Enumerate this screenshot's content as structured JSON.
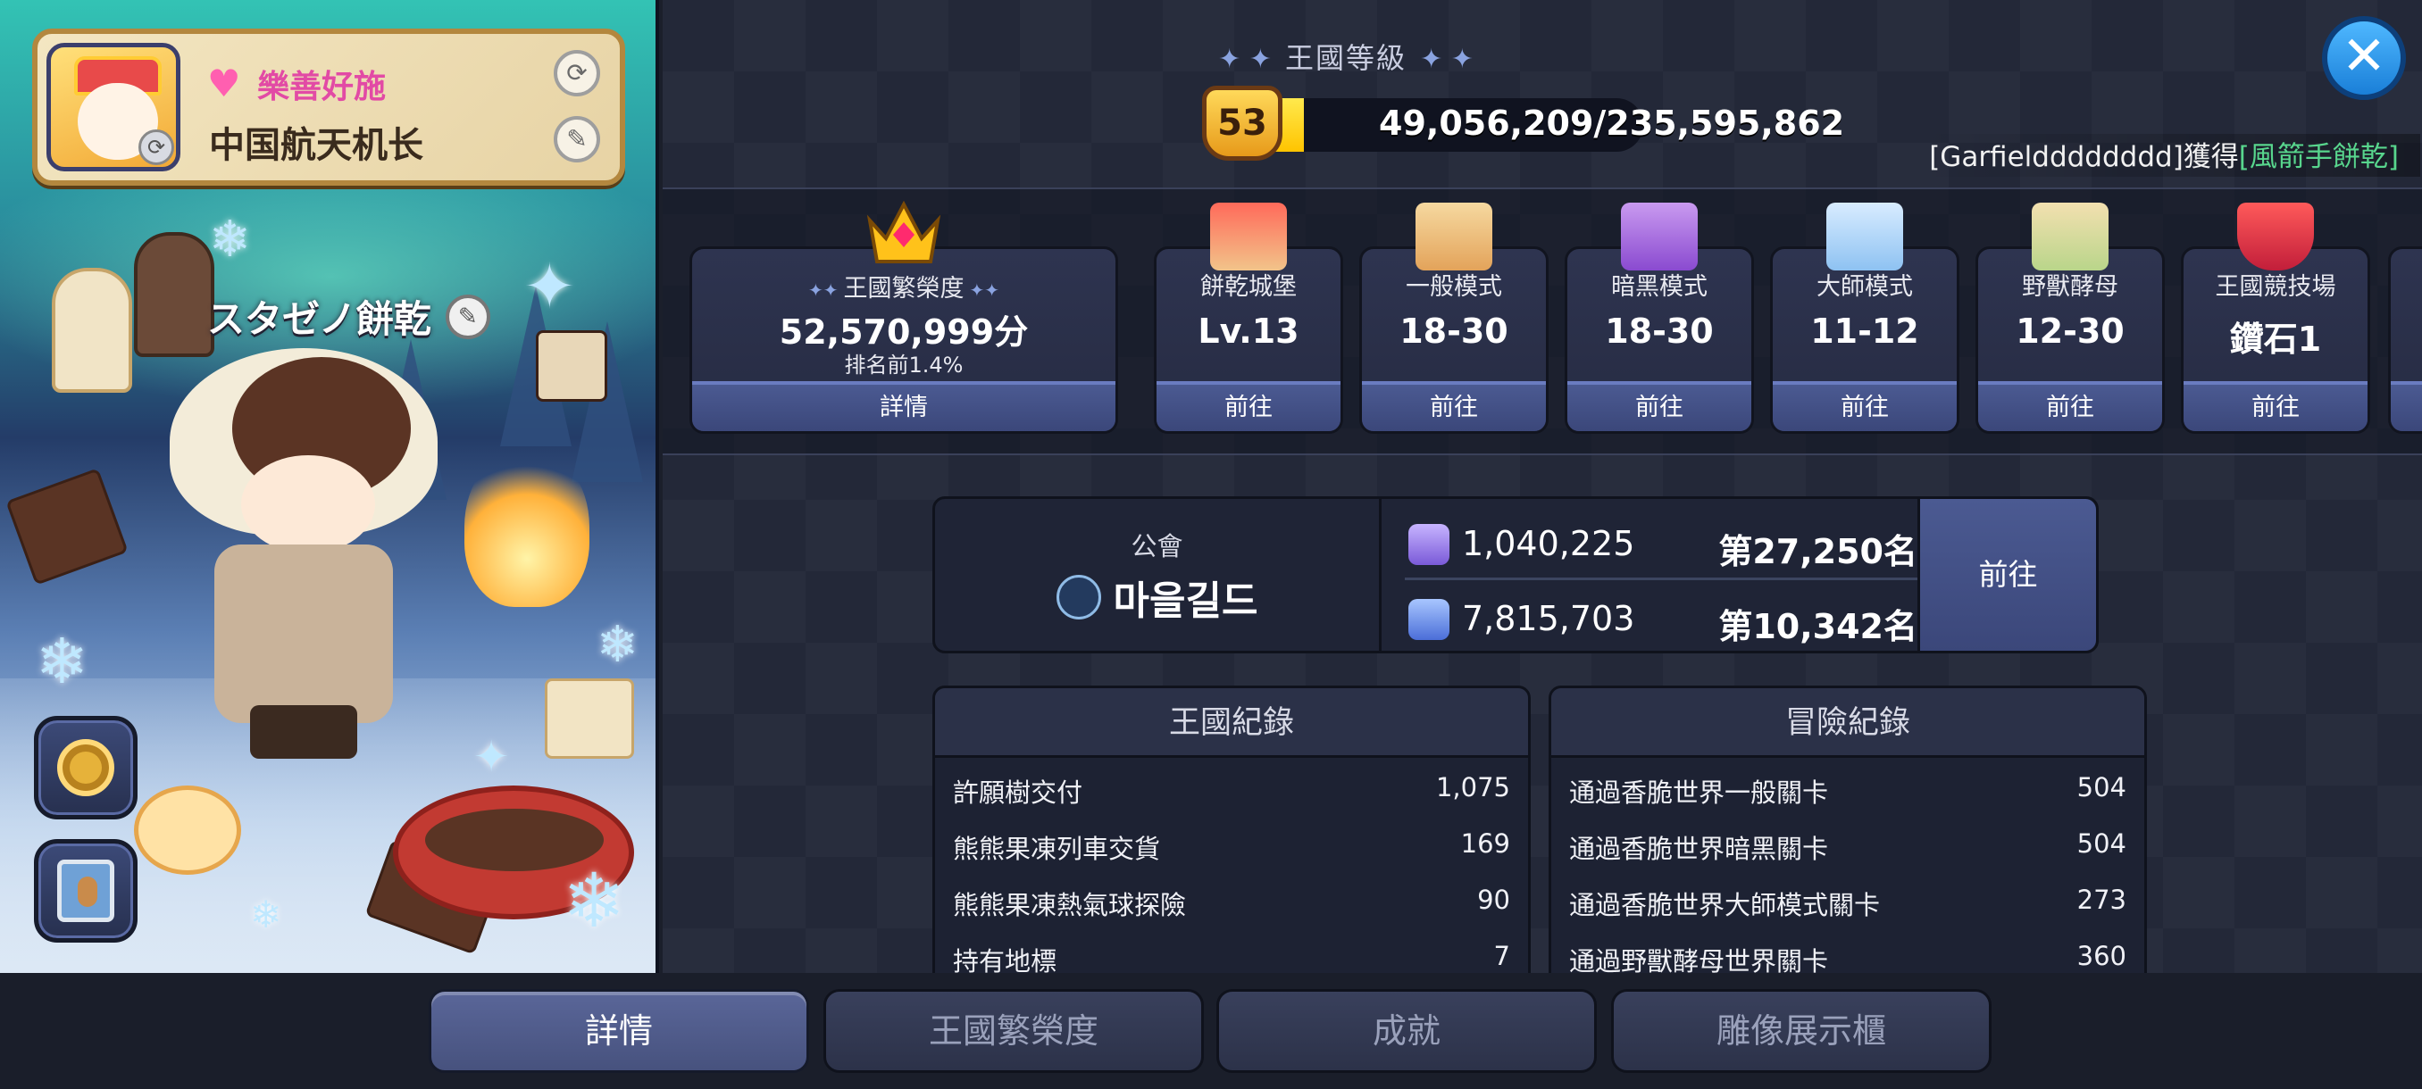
{
  "profile": {
    "title": "樂善好施",
    "name": "中国航天机长"
  },
  "cookie": {
    "name": "スタゼノ餅乾"
  },
  "kingdom_level": {
    "title": "王國等級",
    "level": "53",
    "progress_text": "49,056,209/235,595,862",
    "progress_fraction": 0.208
  },
  "ticker": {
    "prefix": "[Garfieldddddddd]獲得",
    "highlight": "[風箭手餅乾]",
    "highlight_color": "#58d68d"
  },
  "prosperity": {
    "label": "王國繁榮度",
    "value": "52,570,999分",
    "rank": "排名前1.4%",
    "button": "詳情"
  },
  "stats": [
    {
      "label": "餅乾城堡",
      "value": "Lv.13",
      "button": "前往",
      "icon": "castle-icon"
    },
    {
      "label": "一般模式",
      "value": "18-30",
      "button": "前往",
      "icon": "map-normal-icon"
    },
    {
      "label": "暗黑模式",
      "value": "18-30",
      "button": "前往",
      "icon": "map-dark-icon"
    },
    {
      "label": "大師模式",
      "value": "11-12",
      "button": "前往",
      "icon": "map-master-icon"
    },
    {
      "label": "野獸酵母",
      "value": "12-30",
      "button": "前往",
      "icon": "map-beast-icon"
    },
    {
      "label": "王國競技場",
      "value": "鑽石1",
      "button": "前往",
      "icon": "arena-icon"
    }
  ],
  "guild": {
    "label": "公會",
    "name": "마을길드",
    "rows": [
      {
        "score": "1,040,225",
        "rank": "第27,250名"
      },
      {
        "score": "7,815,703",
        "rank": "第10,342名"
      }
    ],
    "button": "前往"
  },
  "kingdom_record": {
    "title": "王國紀錄",
    "rows": [
      {
        "label": "許願樹交付",
        "value": "1,075"
      },
      {
        "label": "熊熊果凍列車交貨",
        "value": "169"
      },
      {
        "label": "熊熊果凍熱氣球探險",
        "value": "90"
      },
      {
        "label": "持有地標",
        "value": "7"
      }
    ]
  },
  "adventure_record": {
    "title": "冒險紀錄",
    "rows": [
      {
        "label": "通過香脆世界一般關卡",
        "value": "504"
      },
      {
        "label": "通過香脆世界暗黑關卡",
        "value": "504"
      },
      {
        "label": "通過香脆世界大師模式關卡",
        "value": "273"
      },
      {
        "label": "通過野獸酵母世界關卡",
        "value": "360"
      }
    ]
  },
  "tabs": [
    {
      "label": "詳情",
      "active": true
    },
    {
      "label": "王國繁榮度",
      "active": false
    },
    {
      "label": "成就",
      "active": false
    },
    {
      "label": "雕像展示櫃",
      "active": false
    }
  ],
  "colors": {
    "accent_blue": "#4b5a92",
    "level_fill": "#ffc400",
    "title_pink": "#e24aa5"
  }
}
